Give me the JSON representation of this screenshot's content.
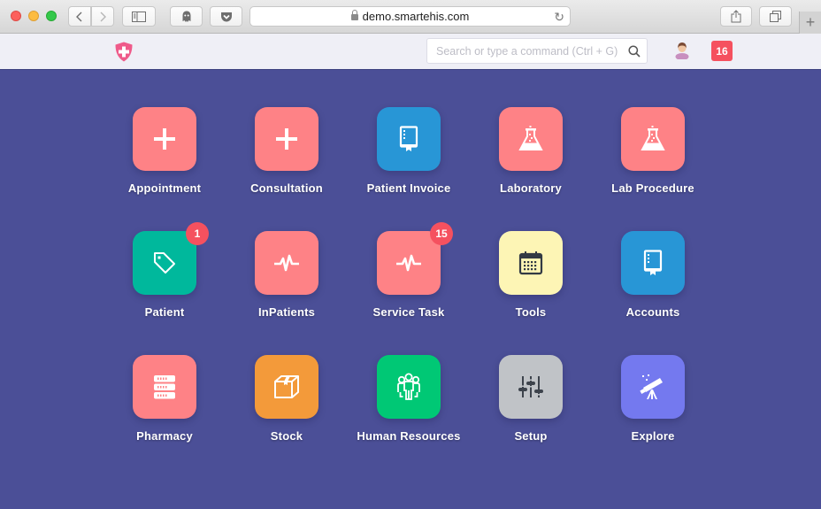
{
  "browser": {
    "url": "demo.smartehis.com",
    "buttons": {
      "back": "‹",
      "forward": "›",
      "new_tab": "+"
    }
  },
  "header": {
    "search_placeholder": "Search or type a command (Ctrl + G)",
    "search_value": "",
    "notifications_count": "16"
  },
  "colors": {
    "background": "#4b4f97",
    "pink": "#fe8286",
    "blue": "#2896d6",
    "teal": "#00b89c",
    "yellow": "#fdf5b5",
    "orange": "#f39a3a",
    "green": "#00c875",
    "gray": "#c0c3c7",
    "violet": "#7479ef",
    "badge": "#f5515f"
  },
  "modules": [
    {
      "label": "Appointment",
      "icon": "plus-icon",
      "color": "#fe8286",
      "badge": null
    },
    {
      "label": "Consultation",
      "icon": "plus-icon",
      "color": "#fe8286",
      "badge": null
    },
    {
      "label": "Patient Invoice",
      "icon": "book-icon",
      "color": "#2896d6",
      "badge": null
    },
    {
      "label": "Laboratory",
      "icon": "flask-icon",
      "color": "#fe8286",
      "badge": null
    },
    {
      "label": "Lab Procedure",
      "icon": "flask-icon",
      "color": "#fe8286",
      "badge": null
    },
    {
      "label": "Patient",
      "icon": "tag-icon",
      "color": "#00b89c",
      "badge": "1"
    },
    {
      "label": "InPatients",
      "icon": "pulse-icon",
      "color": "#fe8286",
      "badge": null
    },
    {
      "label": "Service Task",
      "icon": "pulse-icon",
      "color": "#fe8286",
      "badge": "15"
    },
    {
      "label": "Tools",
      "icon": "calendar-icon",
      "color": "#fdf5b5",
      "badge": null
    },
    {
      "label": "Accounts",
      "icon": "book-icon",
      "color": "#2896d6",
      "badge": null
    },
    {
      "label": "Pharmacy",
      "icon": "server-icon",
      "color": "#fe8286",
      "badge": null
    },
    {
      "label": "Stock",
      "icon": "box-icon",
      "color": "#f39a3a",
      "badge": null
    },
    {
      "label": "Human Resources",
      "icon": "people-icon",
      "color": "#00c875",
      "badge": null
    },
    {
      "label": "Setup",
      "icon": "sliders-icon",
      "color": "#c0c3c7",
      "badge": null
    },
    {
      "label": "Explore",
      "icon": "telescope-icon",
      "color": "#7479ef",
      "badge": null
    }
  ]
}
